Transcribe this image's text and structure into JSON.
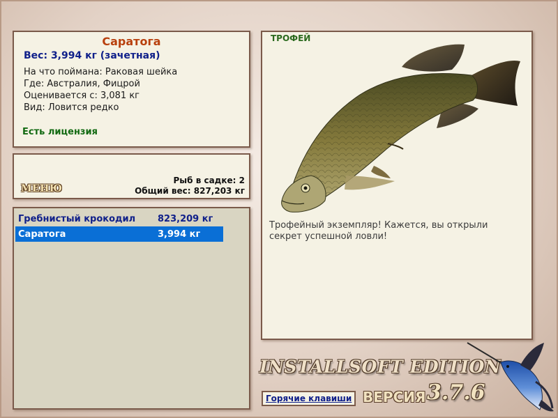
{
  "fish_info": {
    "title": "Саратога",
    "weight": "Вес: 3,994 кг (зачетная)",
    "caught_on": "На что поймана: Раковая шейка",
    "location": "Где: Австралия, Фицрой",
    "valued_from": "Оценивается с: 3,081 кг",
    "rarity": "Вид: Ловится редко",
    "license": "Есть лицензия"
  },
  "menu": {
    "label": "МЕНЮ",
    "fish_count": "Рыб в садке: 2",
    "total_weight": "Общий вес: 827,203 кг"
  },
  "catch_list": [
    {
      "name": "Гребнистый крокодил",
      "weight": "823,209 кг",
      "selected": false
    },
    {
      "name": "Саратога",
      "weight": "3,994 кг",
      "selected": true
    }
  ],
  "trophy": {
    "label": "ТРОФЕЙ",
    "description": "Трофейный экземпляр! Кажется, вы открыли секрет успешной ловли!"
  },
  "footer": {
    "edition": "INSTALLSOFT EDITION",
    "version_label": "ВЕРСИЯ",
    "version": "3.7.6",
    "hotkeys": "Горячие клавиши"
  },
  "colors": {
    "title": "#b8400e",
    "weight": "#10208a",
    "license": "#126a12",
    "selected_row": "#0a6fd6"
  }
}
